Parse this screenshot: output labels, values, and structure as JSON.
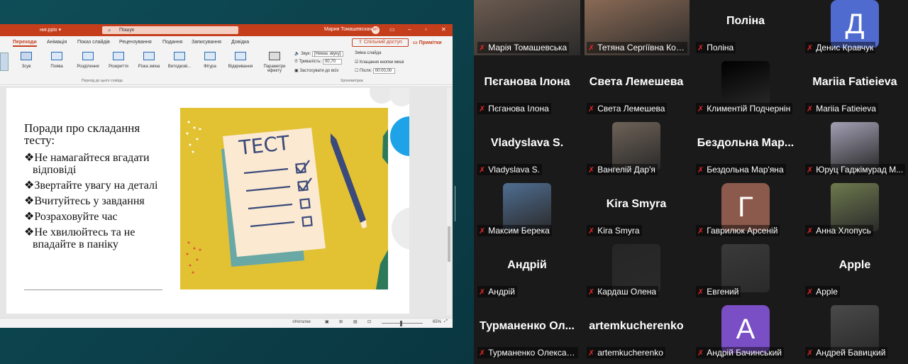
{
  "ppt": {
    "filename": "ниг.pptx ▾",
    "search_placeholder": "Пошук",
    "user": "Мария Томашевская",
    "user_initials": "МТ",
    "tabs": [
      "Переходи",
      "Анімація",
      "Показ слайдів",
      "Рецензування",
      "Подання",
      "Записування",
      "Довідка"
    ],
    "active_tab": "Переходи",
    "share_label": "Спільний доступ",
    "notes_label": "Примітки",
    "effects": [
      "Зсув",
      "Поява",
      "Розділення",
      "Розкриття",
      "Різка зміна",
      "Витодкові...",
      "Фігура",
      "Відкривання"
    ],
    "effect_params": "Параметри ефекту",
    "sound_label": "Звук:",
    "sound_value": "[Немає звуку]",
    "duration_label": "Тривалість:",
    "duration_value": "00,70",
    "apply_all": "Застосувати до всіх",
    "advance_label": "Зміна слайда",
    "on_click": "Клацання кнопки миші",
    "after_label": "Після:",
    "after_value": "00:00,00",
    "group_transition": "Перехід до цього слайда",
    "group_timing": "Хронометраж",
    "zoom": "65%",
    "notes_status": "Нотатки"
  },
  "slide": {
    "heading": "Поради про складання тесту:",
    "bullets": [
      "Не намагайтеся вгадати відповіді",
      "Звертайте увагу на деталі",
      "Вчитуйтесь у завдання",
      "Розраховуйте час",
      "Не хвилюйтесь та не впадайте в паніку"
    ],
    "bullet_glyph": "❖",
    "paper_word": "ТЕСТ"
  },
  "zoom": {
    "tiles": [
      {
        "label": "Марія Томашевська",
        "kind": "photo",
        "color": "#6b5a4f",
        "active": true
      },
      {
        "label": "Тетяна Сергіївна Кова...",
        "kind": "photo",
        "color": "#8a6a55"
      },
      {
        "label": "Поліна",
        "kind": "name",
        "name": "Поліна"
      },
      {
        "label": "Денис Кравчук",
        "kind": "letter",
        "letter": "Д",
        "color": "#4f6bcf"
      },
      {
        "label": "Пєганова Ілона",
        "kind": "name",
        "name": "Пєганова Ілона"
      },
      {
        "label": "Света Лемешева",
        "kind": "name",
        "name": "Света Лемешева"
      },
      {
        "label": "Климентій Подчернін",
        "kind": "photo",
        "color": "#000000"
      },
      {
        "label": "Mariia Fatieieva",
        "kind": "name",
        "name": "Mariia Fatieieva"
      },
      {
        "label": "Vladyslava S.",
        "kind": "name",
        "name": "Vladyslava S."
      },
      {
        "label": "Вангелій Дар'я",
        "kind": "photo",
        "color": "#6e6257"
      },
      {
        "label": "Бездольна Мар'яна",
        "kind": "name",
        "name": "Бездольна Мар..."
      },
      {
        "label": "Юруц Гаджімурад М...",
        "kind": "photo",
        "color": "#a3a0b4"
      },
      {
        "label": "Максим Берека",
        "kind": "photo",
        "color": "#4f6e92"
      },
      {
        "label": "Kira Smyra",
        "kind": "name",
        "name": "Kira Smyra"
      },
      {
        "label": "Гаврилюк Арсеній",
        "kind": "letter",
        "letter": "Г",
        "color": "#8c5a4c"
      },
      {
        "label": "Анна Хлопусь",
        "kind": "photo",
        "color": "#6d7a4e"
      },
      {
        "label": "Андрій",
        "kind": "name",
        "name": "Андрій"
      },
      {
        "label": "Кардаш Олена",
        "kind": "photo",
        "color": "#262626"
      },
      {
        "label": "Евгений",
        "kind": "photo",
        "color": "#3a3a3a"
      },
      {
        "label": "Apple",
        "kind": "name",
        "name": "Apple"
      },
      {
        "label": "Турманенко Олексан...",
        "kind": "name",
        "name": "Турманенко  Ол..."
      },
      {
        "label": "artemkucherenko",
        "kind": "name",
        "name": "artemkucherenko"
      },
      {
        "label": "Андрій Бачинський",
        "kind": "letter",
        "letter": "А",
        "color": "#7a4ec4"
      },
      {
        "label": "Андрей Бавицкий",
        "kind": "photo",
        "color": "#4a4a4a"
      }
    ]
  }
}
